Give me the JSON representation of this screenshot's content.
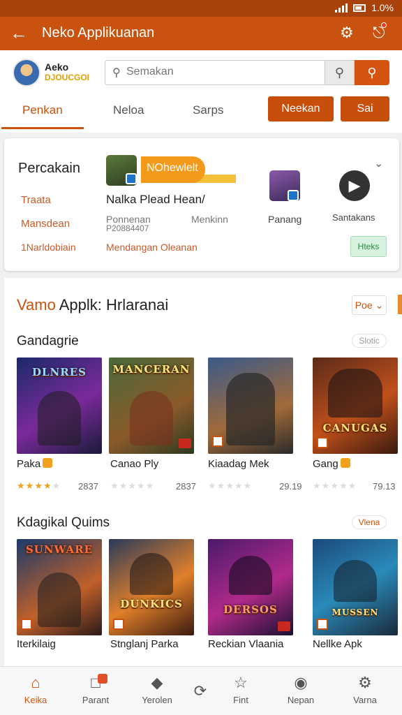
{
  "status_bar": {
    "battery_text": "1.0%"
  },
  "app_bar": {
    "title": "Neko Applikuanan",
    "back_icon": "back-arrow-icon",
    "settings_icon": "gear-icon",
    "notification_icon": "compass-icon"
  },
  "header": {
    "user_name": "Aeko",
    "user_sub": "DJOUCGOI",
    "search_placeholder": "Semakan",
    "tabs": [
      "Penkan",
      "Neloa",
      "Sarps"
    ],
    "buttons": [
      "Neekan",
      "Sai"
    ]
  },
  "card": {
    "title": "Percakain",
    "links_left": [
      "Traata",
      "Mansdean",
      "1Narldobiain"
    ],
    "promo_banner": "NOhewlelt",
    "promo_title": "Nalka Plead Hean/",
    "promo_meta_1": "Ponnenan",
    "promo_meta_2": "P20884407",
    "promo_meta_3": "Menkinn",
    "promo_link": "Mendangan Oleanan",
    "app1_label": "Panang",
    "app2_label": "Santakans",
    "green_button": "Hteks"
  },
  "section": {
    "title_highlight": "Vamo",
    "title_rest": " Applk: Hrlaranai",
    "filter_label": "Poe",
    "rows": [
      {
        "title": "Gandagrie",
        "pill": "Slotic",
        "games": [
          {
            "art_title": "DLNRES",
            "name": "Paka",
            "stars": 4,
            "count": "2837",
            "coin": true
          },
          {
            "art_title": "MANCERAN",
            "name": "Canao Ply",
            "stars": 0,
            "count": "2837",
            "coin": false
          },
          {
            "art_title": "",
            "name": "Kiaadag Mek",
            "stars": 0,
            "count": "29.19",
            "coin": false
          },
          {
            "art_title": "CANUGAS",
            "name": "Gang",
            "stars": 0,
            "count": "79.13",
            "coin": true
          }
        ]
      },
      {
        "title": "Kdagikal Quims",
        "pill": "Vlena",
        "games": [
          {
            "art_title": "SUNWARE",
            "name": "Iterkilaig",
            "coin": false
          },
          {
            "art_title": "DUNKICS",
            "name": "Stnglanj Parka",
            "coin": false
          },
          {
            "art_title": "DERSOS",
            "name": "Reckian Vlaania",
            "coin": false
          },
          {
            "art_title": "MUSSEN",
            "name": "Nellke Apk",
            "coin": true
          }
        ]
      }
    ]
  },
  "bottom_nav": [
    {
      "label": "Keika",
      "icon": "home-icon"
    },
    {
      "label": "Parant",
      "icon": "chat-icon"
    },
    {
      "label": "Yerolen",
      "icon": "tag-icon"
    },
    {
      "label": "",
      "icon": "refresh-icon"
    },
    {
      "label": "Fint",
      "icon": "star-icon"
    },
    {
      "label": "Nepan",
      "icon": "location-icon"
    },
    {
      "label": "Varna",
      "icon": "gear-icon"
    }
  ],
  "colors": {
    "primary": "#c8520e",
    "accent": "#f2a11c",
    "status_bar": "#a8410a"
  }
}
